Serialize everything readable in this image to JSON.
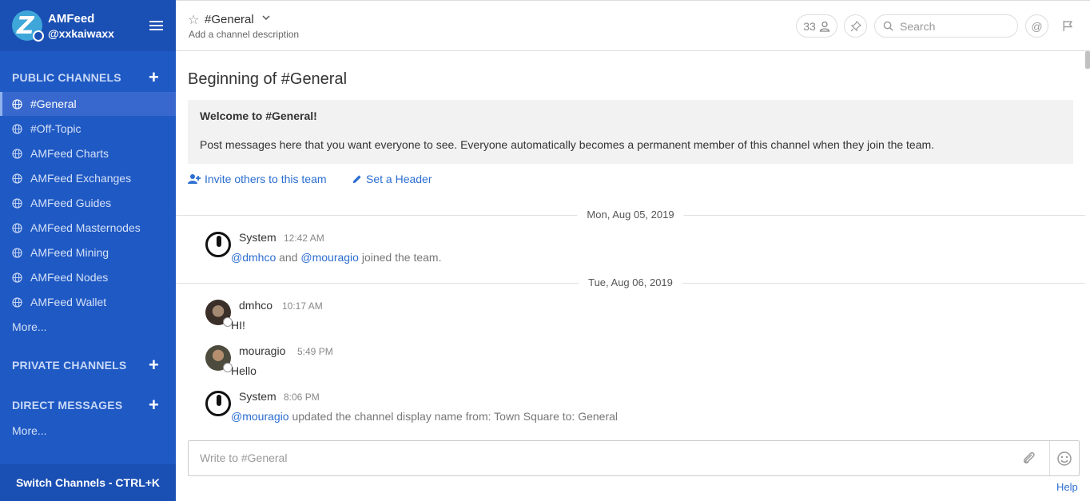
{
  "team": {
    "name": "AMFeed",
    "username": "@xxkaiwaxx",
    "logo_letter": "Z"
  },
  "sidebar": {
    "public_title": "PUBLIC CHANNELS",
    "channels": [
      {
        "label": "#General",
        "active": true
      },
      {
        "label": "#Off-Topic"
      },
      {
        "label": "AMFeed Charts"
      },
      {
        "label": "AMFeed Exchanges"
      },
      {
        "label": "AMFeed Guides"
      },
      {
        "label": "AMFeed Masternodes"
      },
      {
        "label": "AMFeed Mining"
      },
      {
        "label": "AMFeed Nodes"
      },
      {
        "label": "AMFeed Wallet"
      }
    ],
    "more_label": "More...",
    "private_title": "PRIVATE CHANNELS",
    "direct_title": "DIRECT MESSAGES",
    "direct_more_label": "More...",
    "switch_label": "Switch Channels - CTRL+K"
  },
  "header": {
    "channel_name": "#General",
    "description_placeholder": "Add a channel description",
    "member_count": "33",
    "search_placeholder": "Search"
  },
  "main": {
    "intro_title": "Beginning of #General",
    "welcome": "Welcome to #General!",
    "intro_text": "Post messages here that you want everyone to see. Everyone automatically becomes a permanent member of this channel when they join the team.",
    "invite_label": "Invite others to this team",
    "header_label": "Set a Header",
    "dates": [
      "Mon, Aug 05, 2019",
      "Tue, Aug 06, 2019"
    ],
    "posts": [
      {
        "author": "System",
        "time": "12:42 AM",
        "mention1": "@dmhco",
        "and": "and",
        "mention2": "@mouragio",
        "text": "joined the team."
      },
      {
        "author": "dmhco",
        "time": "10:17 AM",
        "text": "HI!"
      },
      {
        "author": "mouragio",
        "time": "5:49 PM",
        "text": "Hello"
      },
      {
        "author": "System",
        "time": "8:06 PM",
        "mention1": "@mouragio",
        "text": "updated the channel display name from: Town Square to: General"
      }
    ]
  },
  "composer": {
    "placeholder": "Write to #General",
    "help_label": "Help"
  },
  "colors": {
    "sidebar": "#1f59c4",
    "sidebar_header": "#1a4fb3",
    "link": "#2b6dd0"
  }
}
